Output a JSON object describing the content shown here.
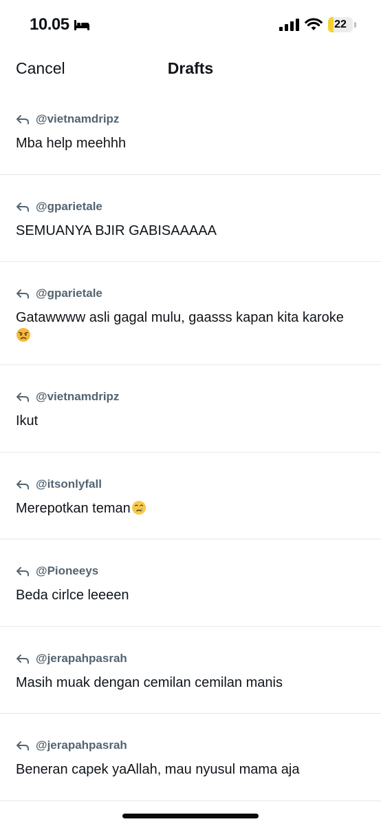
{
  "status_bar": {
    "time": "10.05",
    "battery_level": "22",
    "battery_fraction": 0.22,
    "battery_color": "#f5d030"
  },
  "header": {
    "cancel_label": "Cancel",
    "title": "Drafts"
  },
  "drafts": [
    {
      "reply_to": "@vietnamdripz",
      "text": "Mba help meehhh"
    },
    {
      "reply_to": "@gparietale",
      "text": "SEMUANYA BJIR GABISAAAAA"
    },
    {
      "reply_to": "@gparietale",
      "text": "Gatawwww asli gagal mulu, gaasss kapan kita karoke",
      "emoji": "angry-face-icon"
    },
    {
      "reply_to": "@vietnamdripz",
      "text": "Ikut"
    },
    {
      "reply_to": "@itsonlyfall",
      "text": "Merepotkan teman",
      "emoji": "face-holding-back-tears-icon"
    },
    {
      "reply_to": "@Pioneeys",
      "text": "Beda cirlce leeeen"
    },
    {
      "reply_to": "@jerapahpasrah",
      "text": "Masih muak dengan cemilan cemilan manis"
    },
    {
      "reply_to": "@jerapahpasrah",
      "text": "Beneran capek yaAllah, mau nyusul mama aja"
    }
  ],
  "colors": {
    "meta_gray": "#536471",
    "text": "#0f1419",
    "divider": "#e4e7ea"
  }
}
